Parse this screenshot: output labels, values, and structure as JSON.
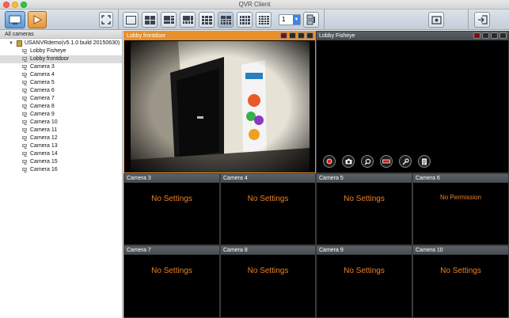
{
  "window": {
    "title": "QVR Client"
  },
  "sidebar": {
    "header": "All cameras",
    "server": "USANVRdemo(v5.1.0 build 20150630)",
    "cameras": [
      "Lobby Fisheye",
      "Lobby frontdoor",
      "Camera 3",
      "Camera 4",
      "Camera 5",
      "Camera 6",
      "Camera 7",
      "Camera 8",
      "Camera 9",
      "Camera 10",
      "Camera 11",
      "Camera 12",
      "Camera 13",
      "Camera 14",
      "Camera 15",
      "Camera 16"
    ],
    "selected_index": 1
  },
  "toolbar": {
    "page_number": "1"
  },
  "grid": {
    "cells": [
      {
        "name": "Lobby frontdoor",
        "message": ""
      },
      {
        "name": "Lobby Fisheye",
        "message": ""
      },
      {
        "name": "Camera 3",
        "message": "No Settings"
      },
      {
        "name": "Camera 4",
        "message": "No Settings"
      },
      {
        "name": "Camera 5",
        "message": "No Settings"
      },
      {
        "name": "Camera 6",
        "message": "No Permission"
      },
      {
        "name": "Camera 7",
        "message": "No Settings"
      },
      {
        "name": "Camera 8",
        "message": "No Settings"
      },
      {
        "name": "Camera 9",
        "message": "No Settings"
      },
      {
        "name": "Camera 10",
        "message": "No Settings"
      }
    ]
  },
  "colors": {
    "accent": "#e8902a",
    "message": "#e8822a"
  }
}
